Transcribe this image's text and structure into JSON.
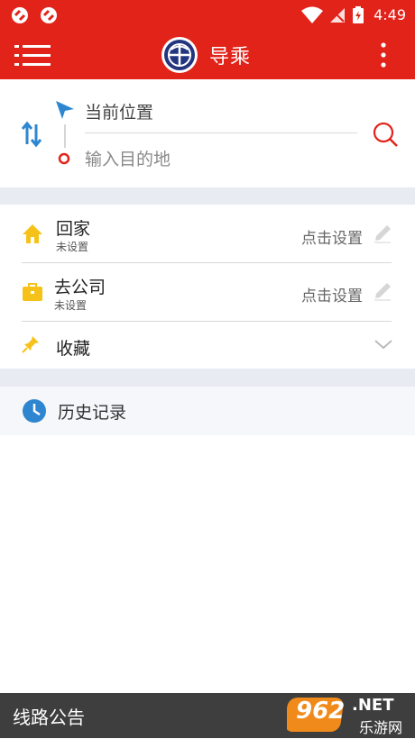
{
  "status_bar": {
    "time": "4:49"
  },
  "app_bar": {
    "title": "导乘"
  },
  "route": {
    "origin_label": "当前位置",
    "destination_placeholder": "输入目的地"
  },
  "shortcuts": [
    {
      "title": "回家",
      "subtitle": "未设置",
      "action": "点击设置",
      "icon": "home-icon",
      "color": "#f6c21a"
    },
    {
      "title": "去公司",
      "subtitle": "未设置",
      "action": "点击设置",
      "icon": "briefcase-icon",
      "color": "#f6c21a"
    },
    {
      "title": "收藏",
      "icon": "pin-icon",
      "color": "#f6c21a"
    }
  ],
  "history": {
    "label": "历史记录"
  },
  "bottom_bar": {
    "label": "线路公告"
  },
  "watermark": {
    "brand": "962",
    "suffix": ".NET",
    "sub": "乐游网"
  },
  "colors": {
    "primary": "#e2231a",
    "accent_blue": "#2f86d0",
    "icon_yellow": "#f6c21a"
  }
}
